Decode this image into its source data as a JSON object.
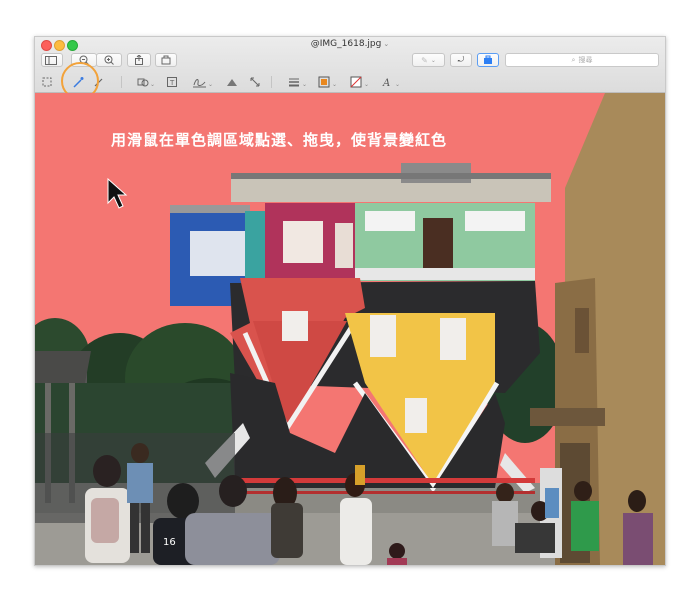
{
  "window": {
    "title": "@IMG_1618.jpg"
  },
  "toolbar": {
    "search_placeholder": "搜尋",
    "search_icon": "magnifier-icon"
  },
  "markup_tools": [
    "rectangular-selection-icon",
    "instant-alpha-icon",
    "sketch-icon",
    "shapes-icon",
    "text-icon",
    "sign-icon",
    "adjust-color-icon",
    "adjust-size-icon",
    "shape-style-icon",
    "border-color-icon",
    "fill-color-icon",
    "text-style-icon"
  ],
  "photo": {
    "caption": "用滑鼠在單色調區域點選、拖曳，使背景變紅色",
    "background_color": "#f47672"
  },
  "sign": {
    "number": "16"
  }
}
